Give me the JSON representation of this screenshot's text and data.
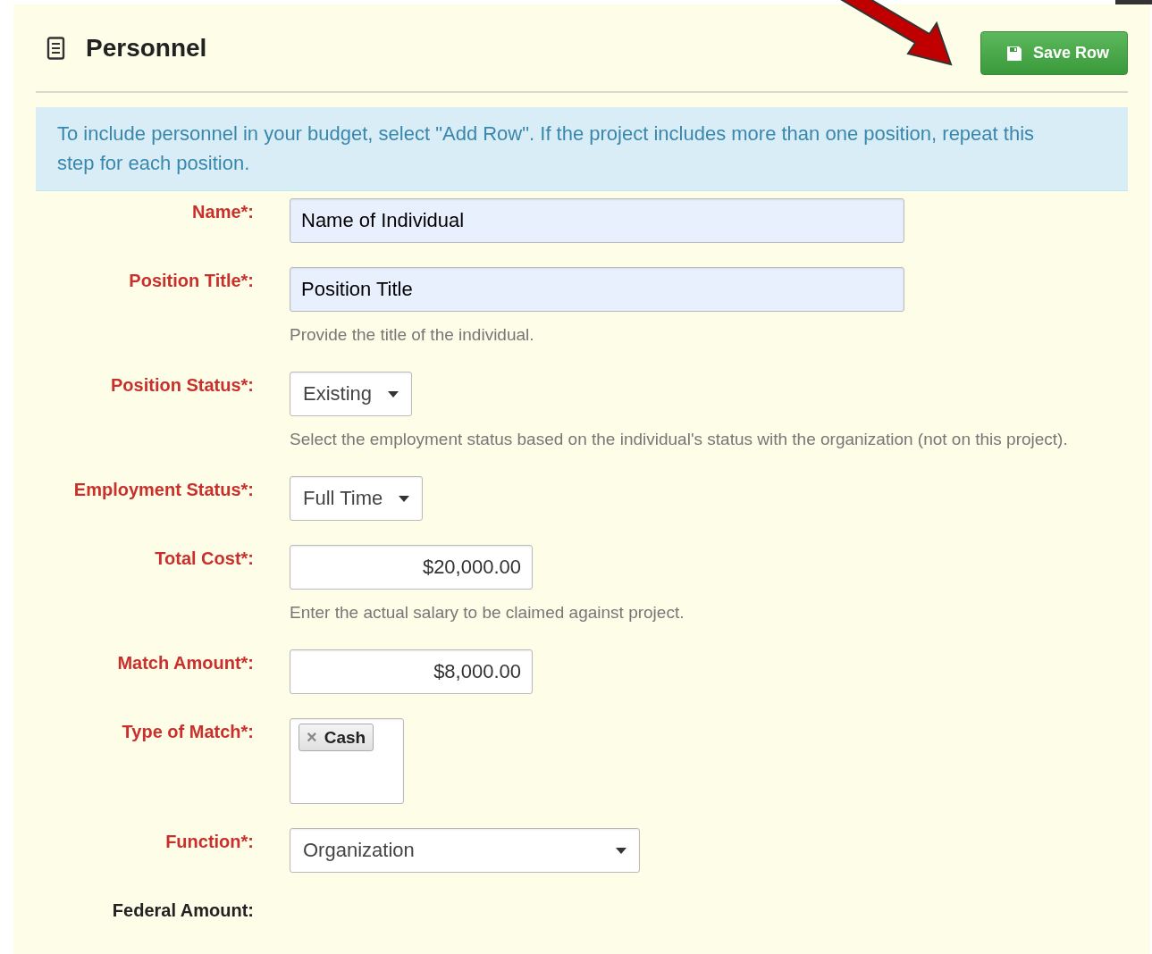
{
  "panel": {
    "title": "Personnel",
    "save_button": "Save Row"
  },
  "notice": "To include personnel in your budget, select \"Add Row\". If the project includes more than one position, repeat this step for each position.",
  "fields": [
    {
      "label": "Name*:",
      "required": true,
      "kind": "text",
      "value": "Name of Individual"
    },
    {
      "label": "Position Title*:",
      "required": true,
      "kind": "text",
      "value": "Position Title",
      "help": "Provide the title of the individual."
    },
    {
      "label": "Position Status*:",
      "required": true,
      "kind": "select",
      "value": "Existing",
      "help": "Select the employment status based on the individual's status with the organization (not on this project)."
    },
    {
      "label": "Employment Status*:",
      "required": true,
      "kind": "select",
      "value": "Full Time"
    },
    {
      "label": "Total Cost*:",
      "required": true,
      "kind": "amount",
      "value": "$20,000.00",
      "help": "Enter the actual salary to be claimed against project."
    },
    {
      "label": "Match Amount*:",
      "required": true,
      "kind": "amount",
      "value": "$8,000.00"
    },
    {
      "label": "Type of Match*:",
      "required": true,
      "kind": "tags",
      "tags": [
        {
          "remove": "×",
          "text": "Cash"
        }
      ]
    },
    {
      "label": "Function*:",
      "required": true,
      "kind": "wide-select",
      "value": "Organization"
    },
    {
      "label": "Federal Amount:",
      "required": false,
      "kind": "none"
    }
  ]
}
